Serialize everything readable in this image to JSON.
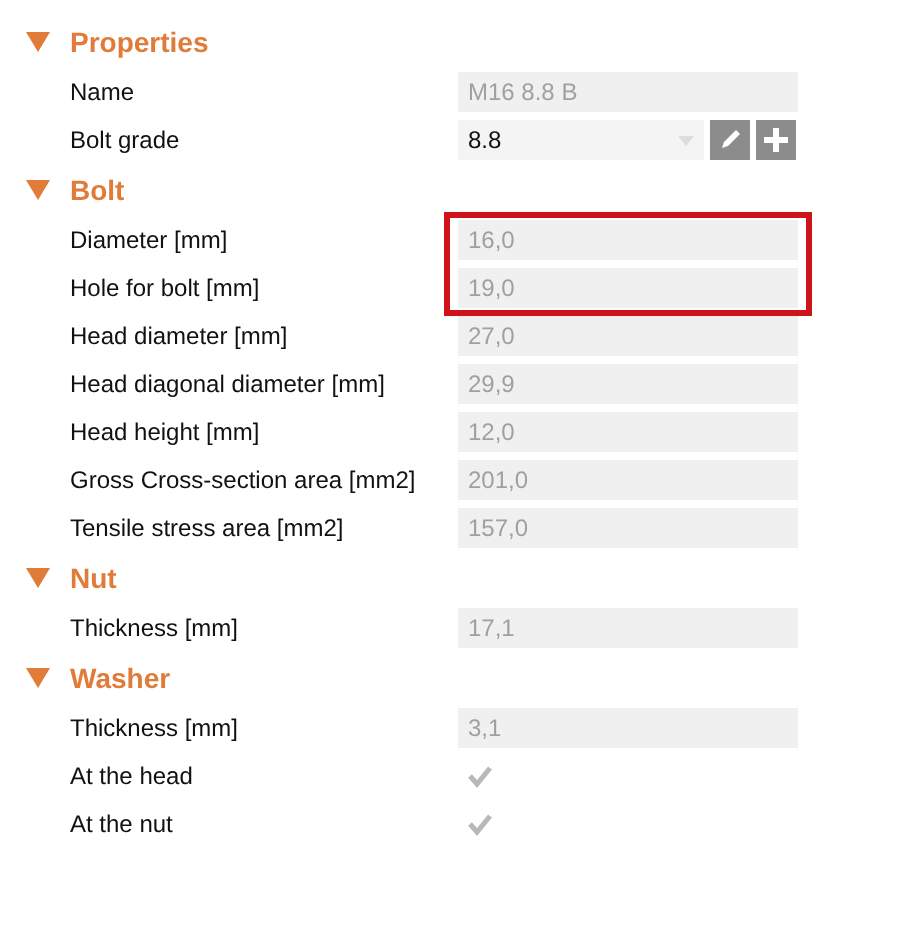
{
  "sections": [
    {
      "title": "Properties",
      "expanded": true,
      "rows": [
        {
          "kind": "field",
          "label": "Name",
          "value": "M16 8.8 B",
          "disabled": true
        },
        {
          "kind": "dropdown",
          "label": "Bolt grade",
          "value": "8.8",
          "disabled": false
        }
      ]
    },
    {
      "title": "Bolt",
      "expanded": true,
      "rows": [
        {
          "kind": "field",
          "label": "Diameter [mm]",
          "value": "16,0",
          "disabled": true,
          "highlighted": true
        },
        {
          "kind": "field",
          "label": "Hole for bolt [mm]",
          "value": "19,0",
          "disabled": true,
          "highlighted": true
        },
        {
          "kind": "field",
          "label": "Head diameter [mm]",
          "value": "27,0",
          "disabled": true
        },
        {
          "kind": "field",
          "label": "Head diagonal diameter [mm]",
          "value": "29,9",
          "disabled": true
        },
        {
          "kind": "field",
          "label": "Head height [mm]",
          "value": "12,0",
          "disabled": true
        },
        {
          "kind": "field",
          "label": "Gross Cross-section area [mm2]",
          "value": "201,0",
          "disabled": true
        },
        {
          "kind": "field",
          "label": "Tensile stress area [mm2]",
          "value": "157,0",
          "disabled": true
        }
      ]
    },
    {
      "title": "Nut",
      "expanded": true,
      "rows": [
        {
          "kind": "field",
          "label": "Thickness [mm]",
          "value": "17,1",
          "disabled": true
        }
      ]
    },
    {
      "title": "Washer",
      "expanded": true,
      "rows": [
        {
          "kind": "field",
          "label": "Thickness [mm]",
          "value": "3,1",
          "disabled": true
        },
        {
          "kind": "checkbox",
          "label": "At the head",
          "checked": true,
          "disabled": true
        },
        {
          "kind": "checkbox",
          "label": "At the nut",
          "checked": true,
          "disabled": true
        }
      ]
    }
  ]
}
